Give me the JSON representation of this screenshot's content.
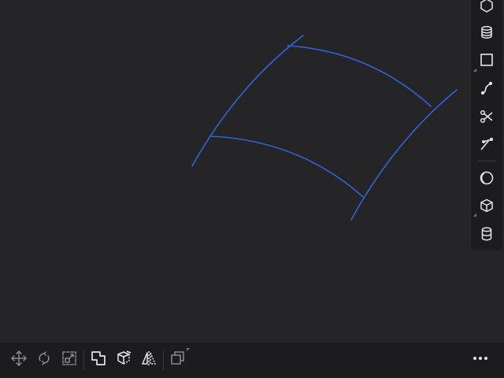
{
  "colors": {
    "background": "#252528",
    "toolbar": "#1c1c1e",
    "icon": "#e6e6e6",
    "icon_dim": "#8a8a8e",
    "curve": "#2f63d8"
  },
  "viewport": {
    "object": "surface-patch-wireframe"
  },
  "right_toolbar": {
    "tools": [
      {
        "icon": "hexagon-icon"
      },
      {
        "icon": "layers-icon"
      },
      {
        "icon": "rectangle-icon"
      },
      {
        "icon": "curve-icon"
      },
      {
        "icon": "scissors-icon"
      },
      {
        "icon": "pen-icon"
      },
      {
        "icon": "sphere-icon"
      },
      {
        "icon": "cube-icon"
      },
      {
        "icon": "cylinder-icon"
      }
    ]
  },
  "bottom_toolbar": {
    "tools": [
      {
        "icon": "move-icon",
        "enabled": false
      },
      {
        "icon": "rotate-icon",
        "enabled": false
      },
      {
        "icon": "scale-icon",
        "enabled": false
      },
      {
        "icon": "boolean-icon",
        "enabled": true
      },
      {
        "icon": "extrude-icon",
        "enabled": true
      },
      {
        "icon": "mirror-icon",
        "enabled": true
      },
      {
        "icon": "duplicate-icon",
        "enabled": false
      },
      {
        "icon": "more-icon",
        "enabled": true
      }
    ]
  }
}
